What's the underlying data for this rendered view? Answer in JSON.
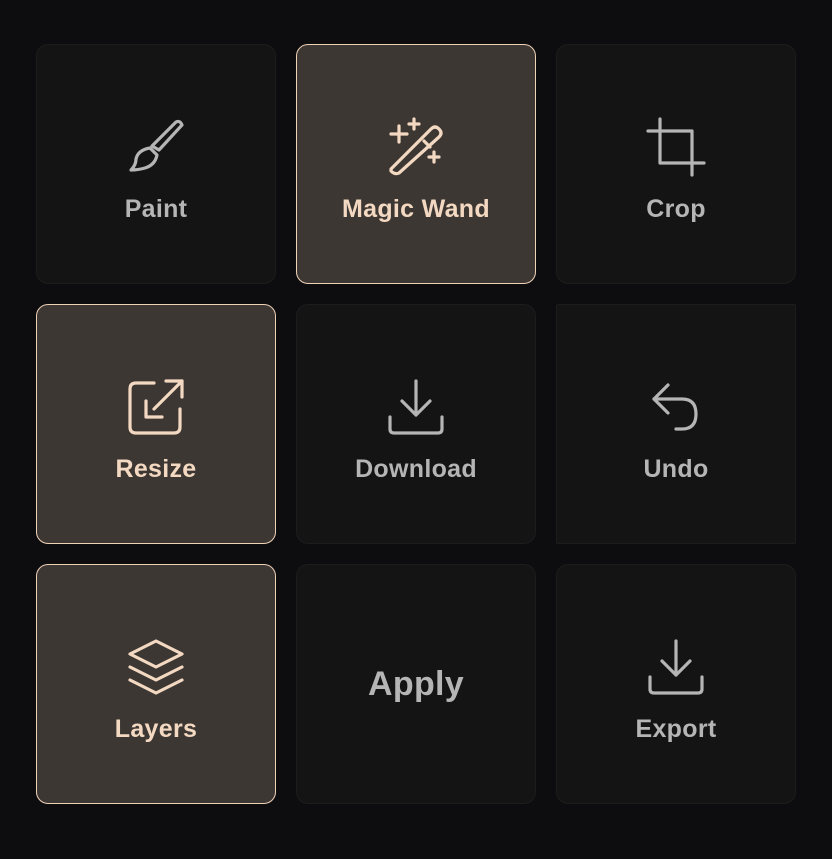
{
  "tools": [
    {
      "label": "Paint",
      "icon": "paintbrush-icon",
      "active": false
    },
    {
      "label": "Magic Wand",
      "icon": "magic-wand-icon",
      "active": true
    },
    {
      "label": "Crop",
      "icon": "crop-icon",
      "active": false
    },
    {
      "label": "Resize",
      "icon": "resize-icon",
      "active": true
    },
    {
      "label": "Download",
      "icon": "download-icon",
      "active": false
    },
    {
      "label": "Undo",
      "icon": "undo-icon",
      "active": false
    },
    {
      "label": "Layers",
      "icon": "layers-icon",
      "active": true
    },
    {
      "label": "Apply",
      "icon": "",
      "active": false
    },
    {
      "label": "Export",
      "icon": "download-icon",
      "active": false
    }
  ],
  "colors": {
    "background": "#0d0d0f",
    "tile": "#141414",
    "tile_active": "#3d3733",
    "accent": "#f4d9c2",
    "text_muted": "#b5b5b5"
  }
}
